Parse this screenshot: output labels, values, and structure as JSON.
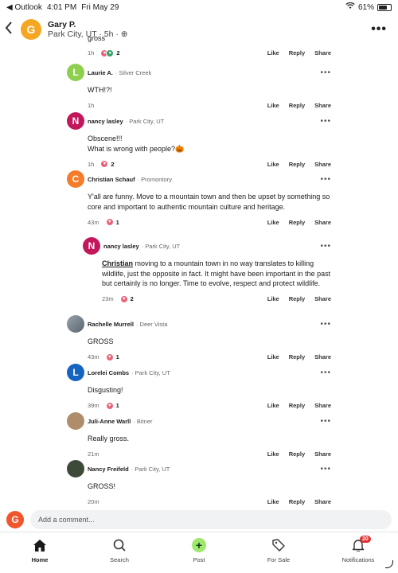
{
  "status_bar": {
    "back_app": "◀ Outlook",
    "time": "4:01 PM",
    "date": "Fri May 29",
    "battery": "61%"
  },
  "header": {
    "avatar_letter": "G",
    "name": "Gary P.",
    "meta": "Park City, UT · 5h · ⊕"
  },
  "colors": {
    "accent_green": "#9fe870",
    "badge_red": "#e0302f"
  },
  "partial_top": {
    "text": "gross",
    "time": "1h",
    "reaction_count": "2"
  },
  "comments": [
    {
      "avatar_letter": "L",
      "avatar_color": "#8fcf4e",
      "name": "Laurie A.",
      "location": "· Silver Creek",
      "lines": [
        "WTH!?!"
      ],
      "time": "1h",
      "reaction_count": ""
    },
    {
      "avatar_letter": "N",
      "avatar_color": "#c2185b",
      "name": "nancy lasley",
      "location": "· Park City, UT",
      "lines": [
        "Obscene!!!",
        "What is wrong with people?🎃"
      ],
      "time": "1h",
      "reaction_count": "2"
    },
    {
      "avatar_letter": "C",
      "avatar_color": "#f57c28",
      "name": "Christian Schauf",
      "location": "· Promontory",
      "lines": [
        "Y'all are funny.  Move to a mountain town and then be upset by something so core and important to authentic mountain culture and heritage."
      ],
      "time": "43m",
      "reaction_count": "1"
    },
    {
      "avatar_letter": "N",
      "avatar_color": "#c2185b",
      "name": "nancy lasley",
      "location": "· Park City, UT",
      "mention": "Christian",
      "lines": [
        " moving to a mountain town in no way translates to killing wildlife, just the opposite in fact. It might have been important in the past but certainly is no longer. Time to evolve, respect and protect wildlife."
      ],
      "time": "23m",
      "reaction_count": "2"
    },
    {
      "avatar_letter": "",
      "avatar_color": "#7d8790",
      "name": "Rachelle Murrell",
      "location": "· Deer Vista",
      "lines": [
        "GROSS"
      ],
      "time": "43m",
      "reaction_count": "1"
    },
    {
      "avatar_letter": "L",
      "avatar_color": "#1565c0",
      "name": "Lorelei Combs",
      "location": "· Park City, UT",
      "lines": [
        "Disgusting!"
      ],
      "time": "39m",
      "reaction_count": "1"
    },
    {
      "avatar_letter": "",
      "avatar_color": "#b08d6a",
      "name": "Juli-Anne Warll",
      "location": "· Bitner",
      "lines": [
        "Really gross."
      ],
      "time": "21m",
      "reaction_count": ""
    },
    {
      "avatar_letter": "",
      "avatar_color": "#3d4a3a",
      "name": "Nancy Freifeld",
      "location": "· Park City, UT",
      "lines": [
        "GROSS!"
      ],
      "time": "20m",
      "reaction_count": ""
    }
  ],
  "actions": {
    "like": "Like",
    "reply": "Reply",
    "share": "Share"
  },
  "composer": {
    "avatar_letter": "G",
    "placeholder": "Add a comment..."
  },
  "tabs": [
    {
      "label": "Home",
      "icon": "home-icon"
    },
    {
      "label": "Search",
      "icon": "search-icon"
    },
    {
      "label": "Post",
      "icon": "plus-icon"
    },
    {
      "label": "For Sale",
      "icon": "tag-icon"
    },
    {
      "label": "Notifications",
      "icon": "bell-icon",
      "badge": "20"
    }
  ]
}
